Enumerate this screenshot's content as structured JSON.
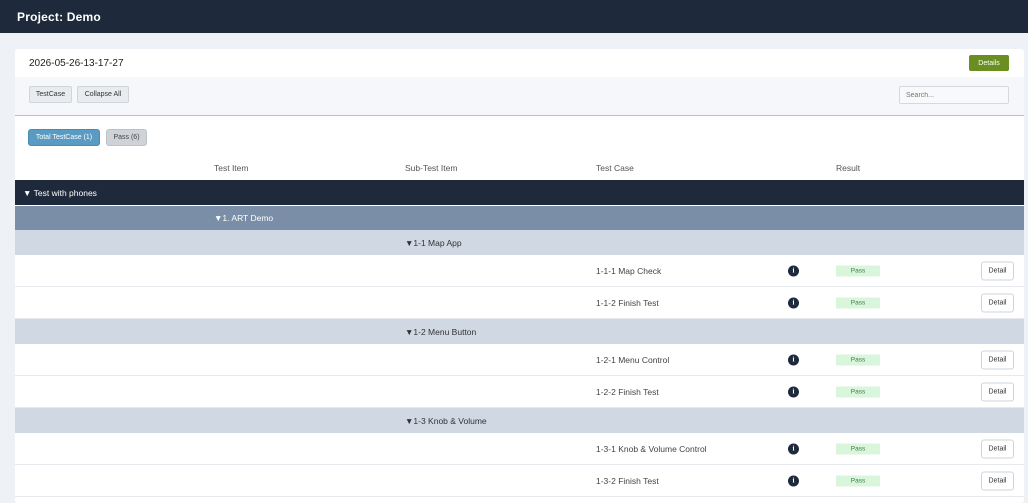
{
  "header": {
    "title": "Project: Demo"
  },
  "report": {
    "timestamp": "2026-05-26-13-17-27",
    "details_label": "Details"
  },
  "toolbar": {
    "testcase_label": "TestCase",
    "collapse_label": "Collapse All",
    "search_placeholder": "Search..."
  },
  "filters": {
    "total_label": "Total TestCase (1)",
    "pass_label": "Pass (6)"
  },
  "columns": {
    "test_item": "Test Item",
    "sub_test_item": "Sub-Test Item",
    "test_case": "Test Case",
    "result": "Result"
  },
  "tree": {
    "group": "▼ Test with phones",
    "item": "▼1. ART Demo",
    "subs": [
      {
        "label": "▼1-1 Map App",
        "cases": [
          {
            "name": "1-1-1 Map Check",
            "info": "i",
            "result": "Pass",
            "detail": "Detail"
          },
          {
            "name": "1-1-2 Finish Test",
            "info": "i",
            "result": "Pass",
            "detail": "Detail"
          }
        ]
      },
      {
        "label": "▼1-2 Menu Button",
        "cases": [
          {
            "name": "1-2-1 Menu Control",
            "info": "i",
            "result": "Pass",
            "detail": "Detail"
          },
          {
            "name": "1-2-2 Finish Test",
            "info": "i",
            "result": "Pass",
            "detail": "Detail"
          }
        ]
      },
      {
        "label": "▼1-3 Knob & Volume",
        "cases": [
          {
            "name": "1-3-1 Knob & Volume Control",
            "info": "i",
            "result": "Pass",
            "detail": "Detail"
          },
          {
            "name": "1-3-2 Finish Test",
            "info": "i",
            "result": "Pass",
            "detail": "Detail"
          }
        ]
      }
    ]
  },
  "colors": {
    "header_bg": "#1e293b",
    "details_btn": "#6b8e23",
    "total_btn": "#5a9bc4",
    "item_row": "#7b8ea8",
    "sub_row": "#cfd8e3",
    "pass_badge": "#d9f6dc"
  }
}
